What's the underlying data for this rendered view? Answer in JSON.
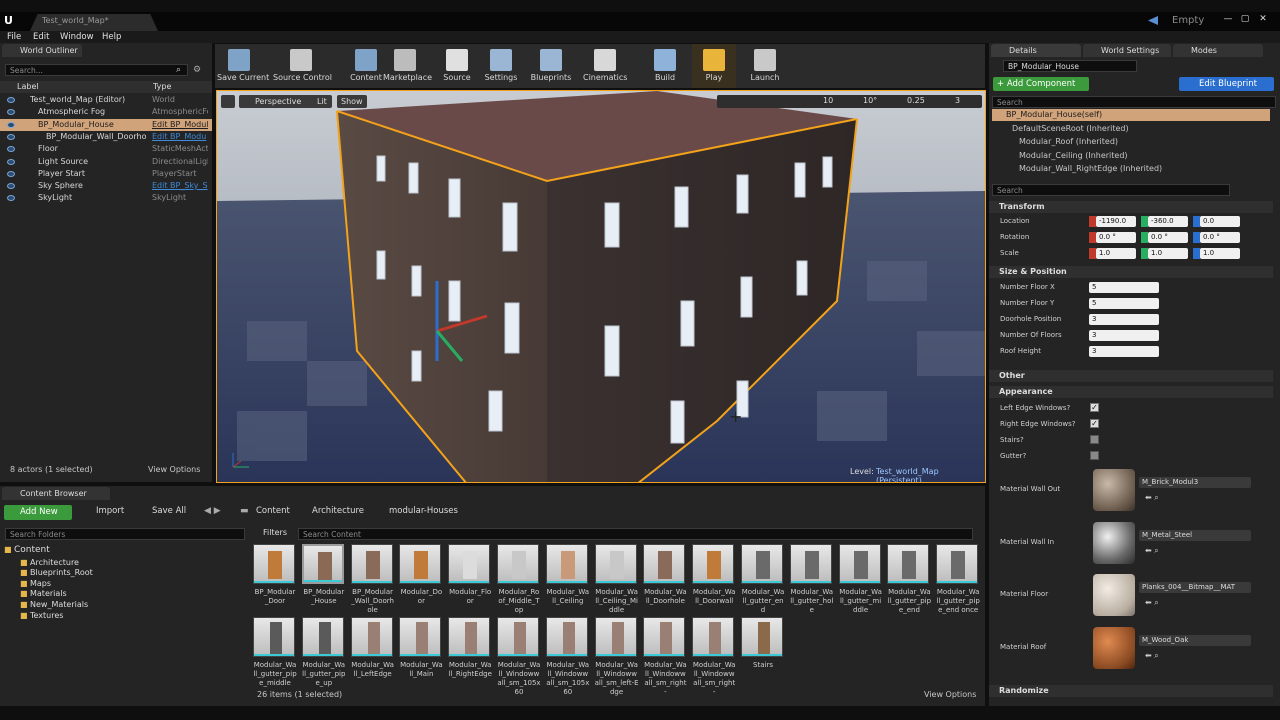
{
  "window": {
    "doc_tab": "Test_world_Map*",
    "project": "Empty",
    "minimize": "—",
    "maximize": "▢",
    "close": "✕"
  },
  "menu": [
    "File",
    "Edit",
    "Window",
    "Help"
  ],
  "outliner": {
    "tab": "World Outliner",
    "search_placeholder": "Search...",
    "col_label": "Label",
    "col_type": "Type",
    "rows": [
      {
        "label": "Test_world_Map (Editor)",
        "type": "World",
        "link": false,
        "indent": 0
      },
      {
        "label": "Atmospheric Fog",
        "type": "AtmosphericFo",
        "link": false,
        "indent": 1
      },
      {
        "label": "BP_Modular_House",
        "type": "Edit BP_Modul",
        "link": true,
        "indent": 1,
        "selected": true
      },
      {
        "label": "BP_Modular_Wall_Doorho",
        "type": "Edit BP_Modu",
        "link": true,
        "indent": 2
      },
      {
        "label": "Floor",
        "type": "StaticMeshActo",
        "link": false,
        "indent": 1
      },
      {
        "label": "Light Source",
        "type": "DirectionalLigh",
        "link": false,
        "indent": 1
      },
      {
        "label": "Player Start",
        "type": "PlayerStart",
        "link": false,
        "indent": 1
      },
      {
        "label": "Sky Sphere",
        "type": "Edit BP_Sky_S",
        "link": true,
        "indent": 1
      },
      {
        "label": "SkyLight",
        "type": "SkyLight",
        "link": false,
        "indent": 1
      }
    ],
    "status": "8 actors (1 selected)",
    "view_options": "View Options"
  },
  "toolbar": [
    "Save Current",
    "Source Control",
    "Content",
    "Marketplace",
    "Source",
    "Settings",
    "Blueprints",
    "Cinematics",
    "Build",
    "Play",
    "Launch"
  ],
  "viewport": {
    "perspective": "Perspective",
    "lit": "Lit",
    "show": "Show",
    "grid": "10",
    "angle": "10°",
    "scale": "0.25",
    "cams": "3",
    "level_label": "Level:",
    "level_name": "Test_world_Map (Persistent)"
  },
  "content_browser": {
    "tab": "Content Browser",
    "add_new": "Add New",
    "import": "Import",
    "save_all": "Save All",
    "path": [
      "Content",
      "Architecture",
      "modular-Houses"
    ],
    "search_folders": "Search Folders",
    "filters": "Filters",
    "search_content": "Search Content",
    "tree": [
      "Content",
      "Architecture",
      "Blueprints_Root",
      "Maps",
      "Materials",
      "New_Materials",
      "Textures"
    ],
    "assets_row1": [
      "BP_Modular_Door",
      "BP_Modular_House",
      "BP_Modular_Wall_Doorhole",
      "Modular_Door",
      "Modular_Floor",
      "Modular_Roof_Middle_Top",
      "Modular_Wall_Ceiling",
      "Modular_Wall_Ceiling_Middle",
      "Modular_Wall_Doorhole",
      "Modular_Wall_Doorwall",
      "Modular_Wall_gutter_end",
      "Modular_Wall_gutter_hole",
      "Modular_Wall_gutter_middle",
      "Modular_Wall_gutter_pipe_end",
      "Modular_Wall_gutter_pipe_end once"
    ],
    "assets_row2": [
      "Modular_Wall_gutter_pipe_middle",
      "Modular_Wall_gutter_pipe_up",
      "Modular_Wall_LeftEdge",
      "Modular_Wall_Main",
      "Modular_Wall_RightEdge",
      "Modular_Wall_Windowwall_sm_105x60",
      "Modular_Wall_Windowwall_sm_105x60",
      "Modular_Wall_Windowwall_sm_left-Edge",
      "Modular_Wall_Windowwall_sm_right-",
      "Modular_Wall_Windowwall_sm_right-",
      "Stairs"
    ],
    "status": "26 items (1 selected)",
    "view_options": "View Options"
  },
  "details": {
    "tabs": [
      "Details",
      "World Settings",
      "Modes"
    ],
    "name": "BP_Modular_House",
    "add_component": "+ Add Component",
    "edit_blueprint": "Edit Blueprint",
    "search": "Search",
    "components": [
      "BP_Modular_House(self)",
      "DefaultSceneRoot (Inherited)",
      "Modular_Roof (Inherited)",
      "Modular_Ceiling (Inherited)",
      "Modular_Wall_RightEdge (Inherited)"
    ],
    "transform": {
      "title": "Transform",
      "location_label": "Location",
      "location": [
        "-1190.0",
        "-360.0",
        "0.0"
      ],
      "rotation_label": "Rotation",
      "rotation": [
        "0.0 °",
        "0.0 °",
        "0.0 °"
      ],
      "scale_label": "Scale",
      "scale": [
        "1.0",
        "1.0",
        "1.0"
      ]
    },
    "size_position": {
      "title": "Size & Position",
      "fields": [
        {
          "label": "Number Floor X",
          "value": "5"
        },
        {
          "label": "Number Floor Y",
          "value": "5"
        },
        {
          "label": "Doorhole Position",
          "value": "3"
        },
        {
          "label": "Number Of Floors",
          "value": "3"
        },
        {
          "label": "Roof Height",
          "value": "3"
        }
      ]
    },
    "other": "Other",
    "appearance": {
      "title": "Appearance",
      "checks": [
        {
          "label": "Left Edge Windows?",
          "checked": true
        },
        {
          "label": "Right Edge Windows?",
          "checked": true
        },
        {
          "label": "Stairs?",
          "checked": false
        },
        {
          "label": "Gutter?",
          "checked": false
        }
      ],
      "materials": [
        {
          "label": "Material Wall Out",
          "value": "M_Brick_Modul3"
        },
        {
          "label": "Material Wall In",
          "value": "M_Metal_Steel"
        },
        {
          "label": "Material Floor",
          "value": "Planks_004__Bitmap__MAT"
        },
        {
          "label": "Material Roof",
          "value": "M_Wood_Oak"
        }
      ]
    },
    "randomize": "Randomize"
  },
  "colors": {
    "accent": "#f3a21a",
    "selection": "#d1a37a",
    "green": "#3b9a3b",
    "blue": "#2a6fcf"
  }
}
